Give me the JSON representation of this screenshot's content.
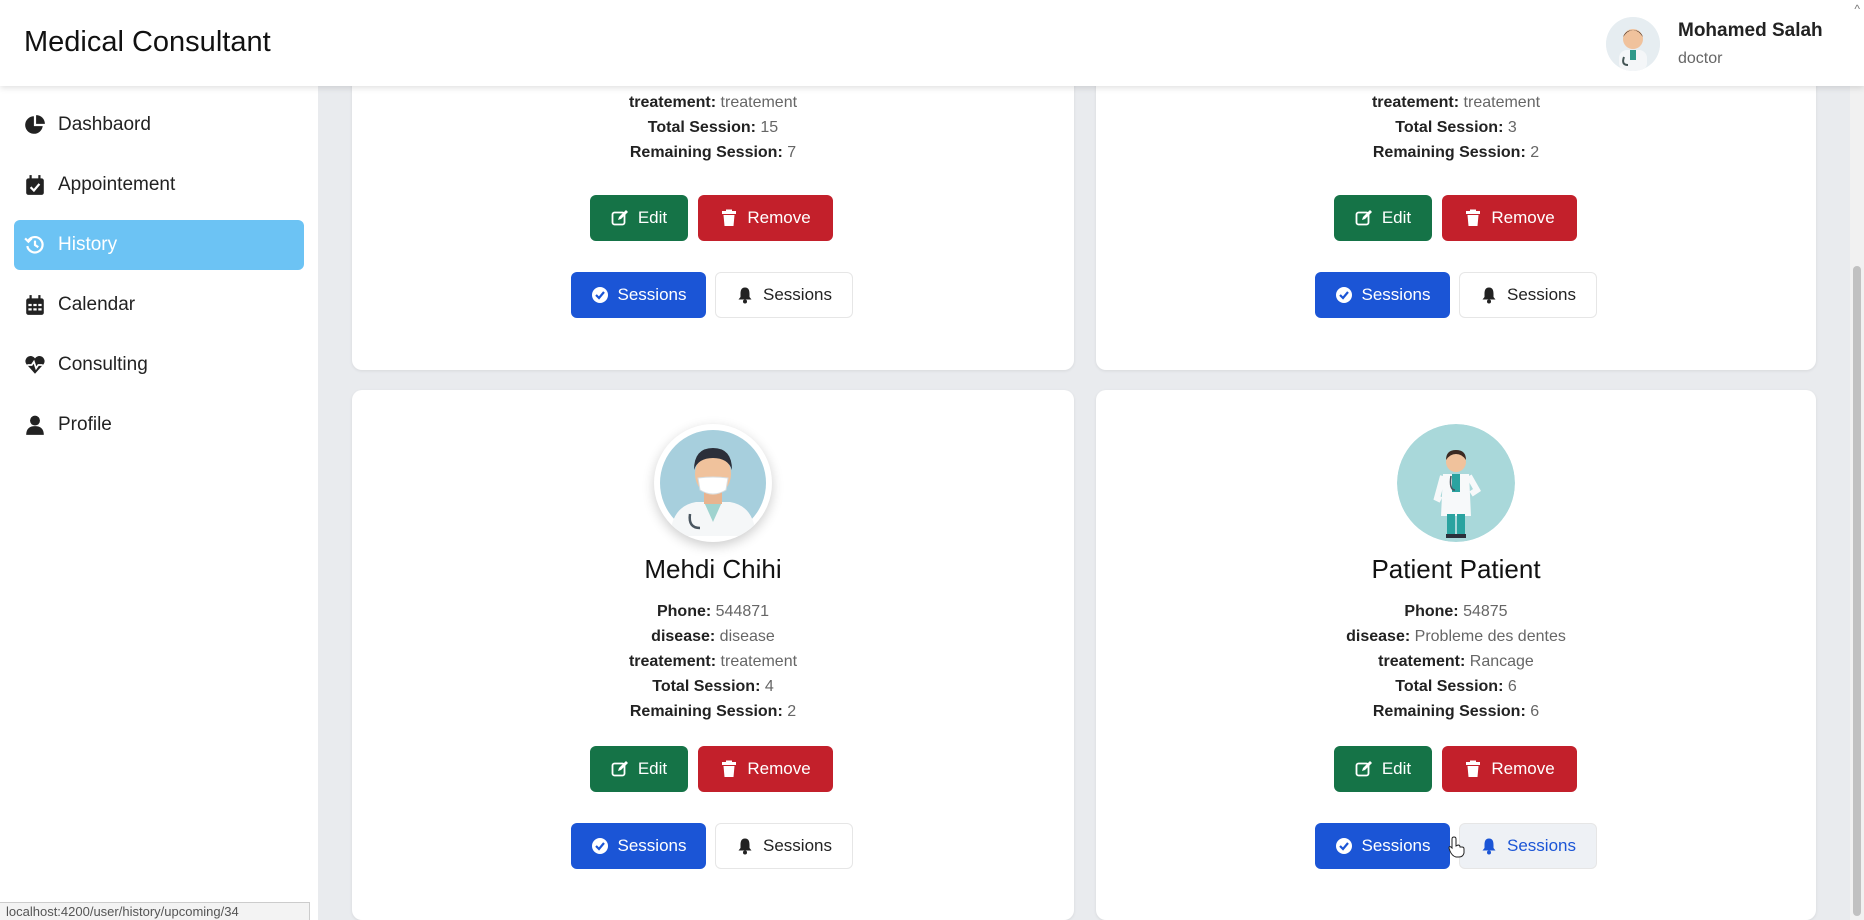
{
  "header": {
    "title": "Medical Consultant",
    "user": {
      "name": "Mohamed Salah",
      "role": "doctor"
    }
  },
  "sidebar": {
    "items": [
      {
        "label": "Dashbaord",
        "icon": "chart-pie-icon"
      },
      {
        "label": "Appointement",
        "icon": "calendar-check-icon"
      },
      {
        "label": "History",
        "icon": "history-icon",
        "active": true
      },
      {
        "label": "Calendar",
        "icon": "calendar-icon"
      },
      {
        "label": "Consulting",
        "icon": "heart-pulse-icon"
      },
      {
        "label": "Profile",
        "icon": "user-icon"
      }
    ]
  },
  "status_url": "localhost:4200/user/history/upcoming/34",
  "labels": {
    "phone": "Phone:",
    "disease": "disease:",
    "treatment": "treatement:",
    "total": "Total Session:",
    "remaining": "Remaining Session:"
  },
  "buttons": {
    "edit": "Edit",
    "remove": "Remove",
    "sessions": "Sessions",
    "sessions_notify": "Sessions"
  },
  "cards": [
    {
      "treatment": "treatement",
      "total": "15",
      "remaining": "7"
    },
    {
      "treatment": "treatement",
      "total": "3",
      "remaining": "2"
    },
    {
      "name": "Mehdi Chihi",
      "phone": "544871",
      "disease": "disease",
      "treatment": "treatement",
      "total": "4",
      "remaining": "2"
    },
    {
      "name": "Patient Patient",
      "phone": "54875",
      "disease": "Probleme des dentes",
      "treatment": "Rancage",
      "total": "6",
      "remaining": "6"
    }
  ]
}
